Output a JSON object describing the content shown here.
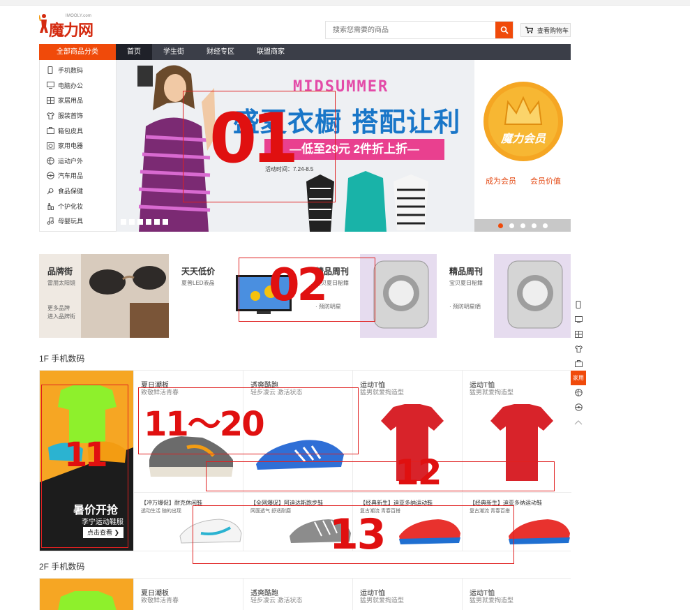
{
  "header": {
    "logo_name": "魔力网",
    "logo_sub": "IMOOLY.com",
    "search_placeholder": "搜索您需要的商品",
    "cart_label": "查看购物车"
  },
  "nav": {
    "category_title": "全部商品分类",
    "items": [
      "首页",
      "学生街",
      "财经专区",
      "联盟商家"
    ]
  },
  "categories": [
    {
      "label": "手机数码",
      "icon": "phone-icon"
    },
    {
      "label": "电脑办公",
      "icon": "monitor-icon"
    },
    {
      "label": "家居用品",
      "icon": "home-icon"
    },
    {
      "label": "服装首饰",
      "icon": "shirt-icon"
    },
    {
      "label": "箱包皮具",
      "icon": "bag-icon"
    },
    {
      "label": "家用电器",
      "icon": "appliance-icon"
    },
    {
      "label": "运动户外",
      "icon": "ball-icon"
    },
    {
      "label": "汽车用品",
      "icon": "wheel-icon"
    },
    {
      "label": "食品保健",
      "icon": "food-icon"
    },
    {
      "label": "个护化妆",
      "icon": "cosmetics-icon"
    },
    {
      "label": "母婴玩具",
      "icon": "toy-icon"
    }
  ],
  "banner": {
    "midsummer": "MIDSUMMER",
    "headline": "盛夏衣橱 搭配让利",
    "ribbon": "—低至29元 2件折上折—",
    "date": "活动时间：7.24-8.5"
  },
  "member": {
    "badge": "魔力会员",
    "link1": "成为会员",
    "link2": "会员价值"
  },
  "promos": [
    {
      "title": "品牌街",
      "sub": "雷朋太阳镜",
      "sub2": "更多品牌\n进入品牌街"
    },
    {
      "title": "天天低价",
      "sub": "夏普LED液晶"
    },
    {
      "title": "精品周刊",
      "sub": "宝贝夏日秘籍",
      "sub2": "· 预防明星"
    },
    {
      "title": "精品周刊",
      "sub": "宝贝夏日秘籍",
      "sub2": "· 预防明星晒"
    }
  ],
  "annotations": {
    "a1": "01",
    "a2": "02",
    "a11": "11",
    "a1120": "11～20",
    "a12": "12",
    "a13": "13"
  },
  "floor1": {
    "title": "1F  手机数码",
    "ad_title": "暑价开抢",
    "ad_sub": "李宁运动鞋服",
    "ad_btn": "点击查看",
    "cells": [
      {
        "t": "夏日潮板",
        "s": "致敬鲜活青春"
      },
      {
        "t": "透爽酷跑",
        "s": "轻步凌云 激活状态"
      },
      {
        "t": "运动T恤",
        "s": "猛男就爱掏造型"
      },
      {
        "t": "运动T恤",
        "s": "猛男就爱掏造型"
      }
    ],
    "small": [
      {
        "t": "【冲万爆促】耐克休闲鞋",
        "s": "透动生活 随的出现"
      },
      {
        "t": "【全网爆促】阿迪达斯跑步鞋",
        "s": "网面透气 舒适耐磨"
      },
      {
        "t": "【经典新生】迪亚多纳运动鞋",
        "s": "复古潮流 青春百搭"
      },
      {
        "t": "【经典新生】迪亚多纳运动鞋",
        "s": "复古潮流 青春百搭"
      }
    ]
  },
  "floor2": {
    "title": "2F  手机数码",
    "cells": [
      {
        "t": "夏日潮板",
        "s": "致敬鲜活青春"
      },
      {
        "t": "透爽酷跑",
        "s": "轻步凌云 激活状态"
      },
      {
        "t": "运动T恤",
        "s": "猛男就爱掏造型"
      },
      {
        "t": "运动T恤",
        "s": "猛男就爱掏造型"
      }
    ]
  },
  "sidenav": {
    "active_label": "家用"
  }
}
